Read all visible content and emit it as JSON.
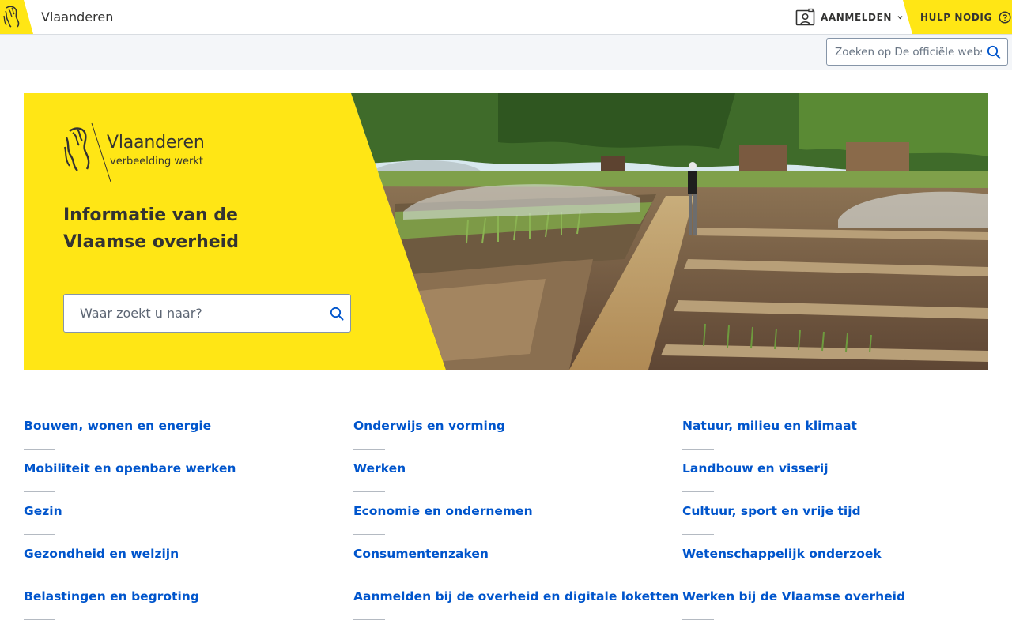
{
  "header": {
    "brand_name": "Vlaanderen",
    "login_label": "AANMELDEN",
    "help_label": "HULP NODIG",
    "accent_color": "#ffe615"
  },
  "site_search": {
    "placeholder": "Zoeken op De officiële website van de Vlaamse overheid"
  },
  "hero": {
    "logo_title": "Vlaanderen",
    "logo_tagline": "verbeelding werkt",
    "title": "Informatie van de Vlaamse overheid",
    "search_placeholder": "Waar zoekt u naar?"
  },
  "themes": {
    "columns": [
      [
        "Bouwen, wonen en energie",
        "Mobiliteit en openbare werken",
        "Gezin",
        "Gezondheid en welzijn",
        "Belastingen en begroting"
      ],
      [
        "Onderwijs en vorming",
        "Werken",
        "Economie en ondernemen",
        "Consumentenzaken",
        "Aanmelden bij de overheid en digitale loketten"
      ],
      [
        "Natuur, milieu en klimaat",
        "Landbouw en visserij",
        "Cultuur, sport en vrije tijd",
        "Wetenschappelijk onderzoek",
        "Werken bij de Vlaamse overheid"
      ]
    ],
    "link_color": "#0055cc"
  },
  "icons": {
    "brand": "flemish-lion-icon",
    "login": "id-card-icon",
    "login_caret": "chevron-down-icon",
    "help": "question-circle-icon",
    "search": "search-icon"
  }
}
